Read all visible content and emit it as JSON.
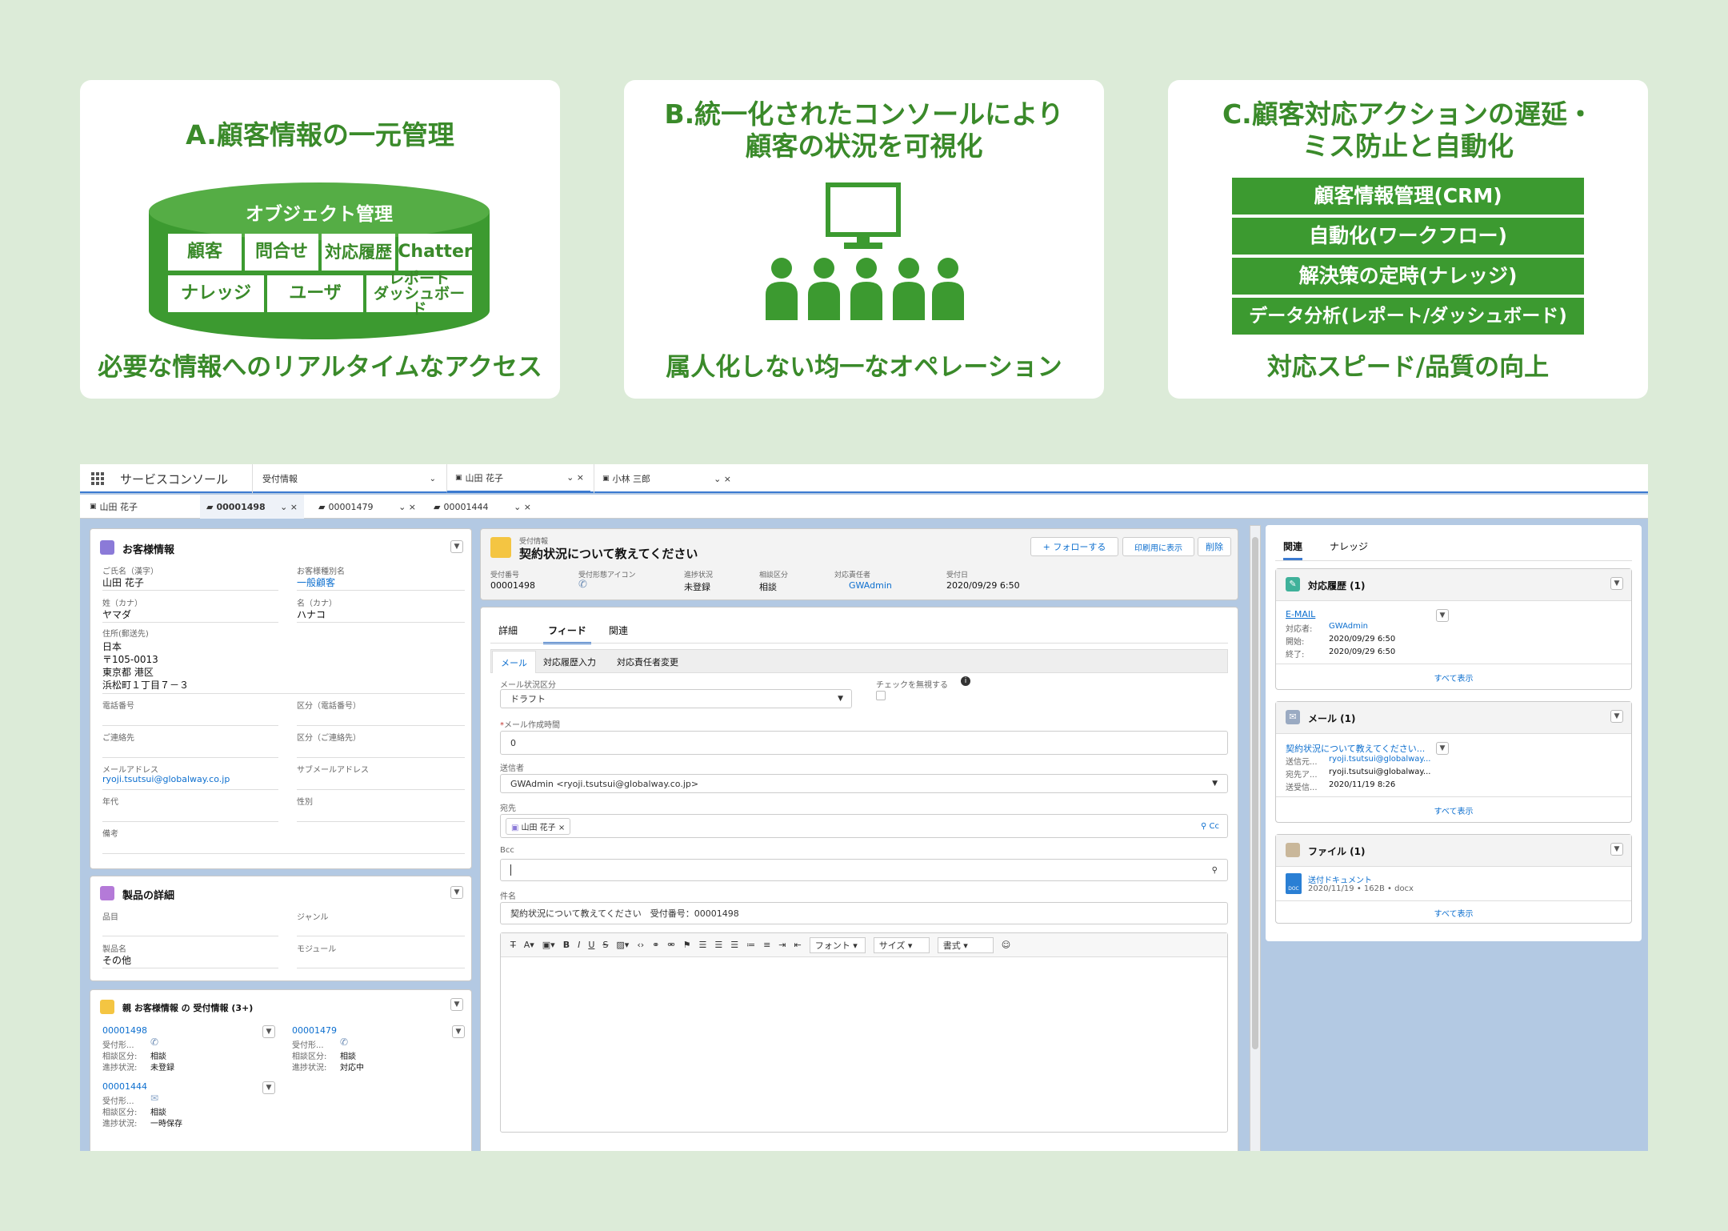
{
  "cards": {
    "a": {
      "title": "A.顧客情報の一元管理",
      "cylinder_title": "オブジェクト管理",
      "cells": [
        "顧客",
        "問合せ",
        "対応履歴",
        "Chatter",
        "ナレッジ",
        "ユーザ",
        "レポート",
        "ダッシュボード"
      ],
      "subtitle": "必要な情報へのリアルタイムなアクセス"
    },
    "b": {
      "title_l1": "B.統一化されたコンソールにより",
      "title_l2": "顧客の状況を可視化",
      "subtitle": "属人化しない均一なオペレーション"
    },
    "c": {
      "title_l1": "C.顧客対応アクションの遅延・",
      "title_l2": "ミス防止と自動化",
      "boxes": [
        "顧客情報管理(CRM)",
        "自動化(ワークフロー)",
        "解決策の定時(ナレッジ)",
        "データ分析(レポート/ダッシュボード)"
      ],
      "subtitle": "対応スピード/品質の向上"
    }
  },
  "colors": {
    "green": "#3a8a2a",
    "bg": "#dcebd8",
    "link": "#0d6fcf"
  },
  "console": {
    "app_name": "サービスコンソール",
    "tabs": [
      "受付情報",
      "山田 花子",
      "小林 三郎"
    ],
    "subtabs": [
      "山田 花子",
      "00001498",
      "00001479",
      "00001444"
    ],
    "left": {
      "title": "お客様情報",
      "f": {
        "name_l": "ご氏名（漢字）",
        "name_v": "山田 花子",
        "cls_l": "お客様種別名",
        "cls_v": "一般顧客",
        "sei_l": "姓（カナ）",
        "sei_v": "ヤマダ",
        "mei_l": "名（カナ）",
        "mei_v": "ハナコ",
        "addr_l": "住所(郵送先)",
        "addr1": "日本",
        "addr2": "〒105-0013",
        "addr3": "東京都 港区",
        "addr4": "浜松町１丁目７－３",
        "tel_l": "電話番号",
        "tel_k": "区分（電話番号）",
        "other_l": "ご連絡先",
        "other_k": "区分（ご連絡先）",
        "mail_l": "メールアドレス",
        "mail_v": "ryoji.tsutsui@globalway.co.jp",
        "sub_l": "サブメールアドレス",
        "age_l": "年代",
        "sex_l": "性別",
        "note_l": "備考"
      },
      "prod_title": "製品の詳細",
      "p": {
        "item_l": "品目",
        "genre_l": "ジャンル",
        "name_l": "製品名",
        "name_v": "その他",
        "mod_l": "モジュール"
      },
      "rel_title": "親 お客様情報 の 受付情報 (3+)",
      "recs": [
        {
          "id": "00001498",
          "k1": "受付形...",
          "k2": "相談区分:",
          "v2": "相談",
          "k3": "進捗状況:",
          "v3": "未登録"
        },
        {
          "id": "00001479",
          "k1": "受付形...",
          "k2": "相談区分:",
          "v2": "相談",
          "k3": "進捗状況:",
          "v3": "対応中"
        },
        {
          "id": "00001444",
          "k1": "受付形...",
          "k2": "相談区分:",
          "v2": "相談",
          "k3": "進捗状況:",
          "v3": "一時保存"
        }
      ]
    },
    "center": {
      "obj": "受付情報",
      "title": "契約状況について教えてください",
      "follow": "+ フォローする",
      "print": "印刷用に表示",
      "del": "削除",
      "hl": {
        "l1": "受付番号",
        "v1": "00001498",
        "l2": "受付形態アイコン",
        "l3": "進捗状況",
        "v3": "未登録",
        "l4": "相談区分",
        "v4": "相談",
        "l5": "対応責任者",
        "v5": "GWAdmin",
        "l6": "受付日",
        "v6": "2020/09/29 6:50"
      },
      "tabs": [
        "詳細",
        "フィード",
        "関連"
      ],
      "subtabs": [
        "メール",
        "対応履歴入力",
        "対応責任者変更"
      ],
      "form": {
        "status_l": "メール状況区分",
        "status_v": "ドラフト",
        "check_l": "チェックを無視する",
        "time_l": "メール作成時間",
        "time_v": "0",
        "from_l": "送信者",
        "from_v": "GWAdmin <ryoji.tsutsui@globalway.co.jp>",
        "to_l": "宛先",
        "to_v": "山田 花子",
        "cc": "Cc",
        "bcc_l": "Bcc",
        "subj_l": "件名",
        "subj_v": "契約状況について教えてください　受付番号：00001498",
        "font": "フォント",
        "size": "サイズ",
        "style": "書式"
      }
    },
    "right": {
      "tabs": [
        "関連",
        "ナレッジ"
      ],
      "hist_title": "対応履歴 (1)",
      "hist": {
        "type": "E-MAIL",
        "k1": "対応者:",
        "v1": "GWAdmin",
        "k2": "開始:",
        "v2": "2020/09/29 6:50",
        "k3": "終了:",
        "v3": "2020/09/29 6:50"
      },
      "all": "すべて表示",
      "mail_title": "メール (1)",
      "mail": {
        "subject": "契約状況について教えてください...",
        "k1": "送信元...",
        "v1": "ryoji.tsutsui@globalway...",
        "k2": "宛先ア...",
        "v2": "ryoji.tsutsui@globalway...",
        "k3": "送受信...",
        "v3": "2020/11/19 8:26"
      },
      "file_title": "ファイル (1)",
      "file": {
        "name": "送付ドキュメント",
        "meta": "2020/11/19 • 162B • docx",
        "ext": "DOC"
      }
    }
  }
}
